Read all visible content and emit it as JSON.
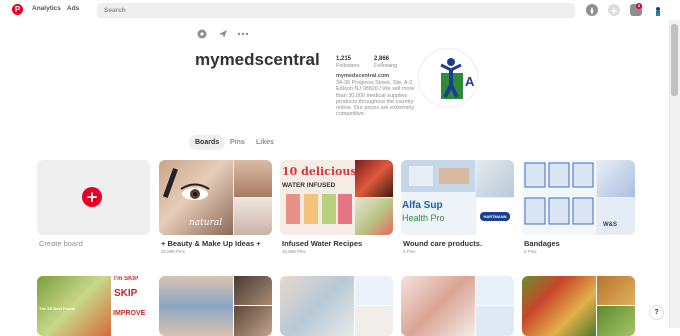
{
  "header": {
    "logo_letter": "P",
    "analytics": "Analytics",
    "ads": "Ads",
    "search_placeholder": "Search",
    "notification_count": "8"
  },
  "profile": {
    "name": "mymedscentral",
    "followers_count": "1,215",
    "followers_label": "Followers",
    "following_count": "2,866",
    "following_label": "Following",
    "website": "mymedscentral.com",
    "about": "34-36 Progress Street, Ste. A-2 Edison NJ 08820 / We sell more than 30,000 medical supplies products throughout the country online. Our prices are extremely competitive.",
    "avatar_letter": "A"
  },
  "tabs": [
    "Boards",
    "Pins",
    "Likes"
  ],
  "create_board_label": "Create board",
  "boards": [
    {
      "title": "+ Beauty & Make Up Ideas +",
      "pins": "32,898 Pins"
    },
    {
      "title": "Infused Water Recipes",
      "pins": "10,608 Pins"
    },
    {
      "title": "Wound care products.",
      "pins": "9 Pins"
    },
    {
      "title": "Bandages",
      "pins": "6 Pins"
    }
  ],
  "board_overlays": {
    "infused_line1": "10 delicious",
    "infused_line2": "WATER INFUSED",
    "wound_brand": "HARTMANN",
    "wound_text1": "Alfa Sup",
    "wound_text2": "Health Pro",
    "bandage_text": "W&S",
    "beauty_text": "natural"
  },
  "row2_overlays": {
    "skip1": "I'm SKIP",
    "skip2": "SKIP",
    "skip3": "IMPROVE",
    "food1": "The 5S Best Foods"
  },
  "help": "?",
  "colors": {
    "brand": "#e60023",
    "muted": "#8e8e8e"
  }
}
